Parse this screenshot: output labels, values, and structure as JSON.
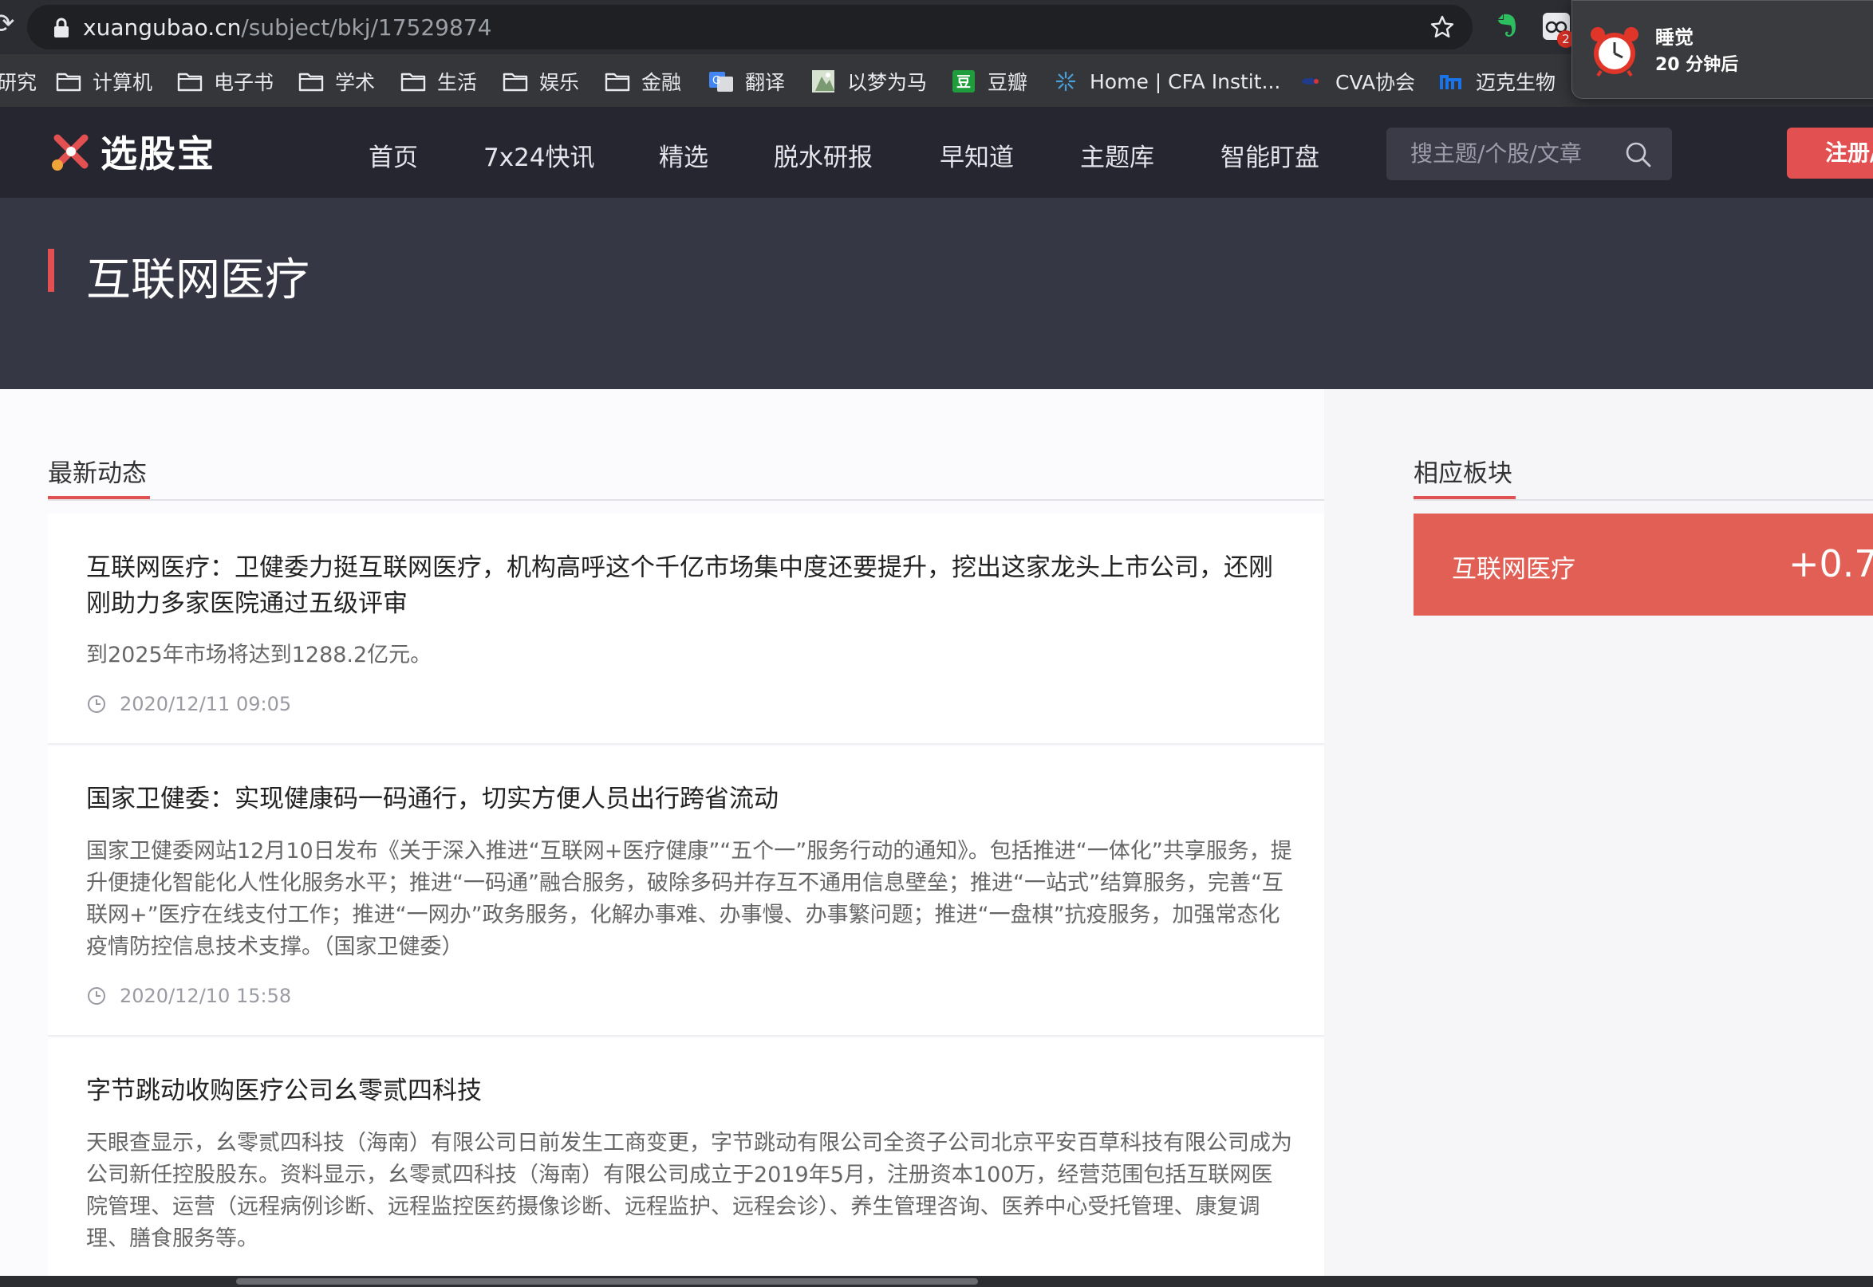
{
  "browser": {
    "url_host": "xuangubao.cn",
    "url_path": "/subject/bkj/17529874",
    "bookmarks": [
      {
        "label": "研究",
        "icon": "folder-icon"
      },
      {
        "label": "计算机",
        "icon": "folder-icon"
      },
      {
        "label": "电子书",
        "icon": "folder-icon"
      },
      {
        "label": "学术",
        "icon": "folder-icon"
      },
      {
        "label": "生活",
        "icon": "folder-icon"
      },
      {
        "label": "娱乐",
        "icon": "folder-icon"
      },
      {
        "label": "金融",
        "icon": "folder-icon"
      },
      {
        "label": "翻译",
        "icon": "translate-icon"
      },
      {
        "label": "以梦为马",
        "icon": "site-favicon"
      },
      {
        "label": "豆瓣",
        "icon": "douban-icon"
      },
      {
        "label": "Home | CFA Instit...",
        "icon": "cfa-icon"
      },
      {
        "label": "CVA协会",
        "icon": "cva-icon"
      },
      {
        "label": "迈克生物",
        "icon": "maccura-icon"
      }
    ],
    "extension_badge": "2"
  },
  "notification": {
    "title": "睡觉",
    "subtitle": "20 分钟后"
  },
  "site": {
    "logo_text": "选股宝",
    "nav": [
      "首页",
      "7x24快讯",
      "精选",
      "脱水研报",
      "早知道",
      "主题库",
      "智能盯盘"
    ],
    "search_placeholder": "搜主题/个股/文章",
    "register_label": "注册/"
  },
  "banner": {
    "title": "互联网医疗"
  },
  "feed": {
    "heading": "最新动态",
    "items": [
      {
        "title": "互联网医疗：卫健委力挺互联网医疗，机构高呼这个千亿市场集中度还要提升，挖出这家龙头上市公司，还刚刚助力多家医院通过五级评审",
        "summary": "到2025年市场将达到1288.2亿元。",
        "time": "2020/12/11 09:05"
      },
      {
        "title": "国家卫健委：实现健康码一码通行，切实方便人员出行跨省流动",
        "summary": "国家卫健委网站12月10日发布《关于深入推进“互联网+医疗健康”“五个一”服务行动的通知》。包括推进“一体化”共享服务，提升便捷化智能化人性化服务水平；推进“一码通”融合服务，破除多码并存互不通用信息壁垒；推进“一站式”结算服务，完善“互联网+”医疗在线支付工作；推进“一网办”政务服务，化解办事难、办事慢、办事繁问题；推进“一盘棋”抗疫服务，加强常态化疫情防控信息技术支撑。（国家卫健委）",
        "time": "2020/12/10 15:58"
      },
      {
        "title": "字节跳动收购医疗公司幺零贰四科技",
        "summary": "天眼查显示，幺零贰四科技（海南）有限公司日前发生工商变更，字节跳动有限公司全资子公司北京平安百草科技有限公司成为公司新任控股股东。资料显示，幺零贰四科技（海南）有限公司成立于2019年5月，注册资本100万，经营范围包括互联网医院管理、运营（远程病例诊断、远程监控医药摄像诊断、远程监护、远程会诊）、养生管理咨询、医养中心受托管理、康复调理、膳食服务等。"
      }
    ]
  },
  "sidebar": {
    "heading": "相应板块",
    "sector": {
      "name": "互联网医疗",
      "change": "+0.7"
    }
  },
  "colors": {
    "brand_red": "#e25051",
    "header_bg": "#252630",
    "banner_bg": "#353745",
    "sector_bg": "#e25f55"
  }
}
